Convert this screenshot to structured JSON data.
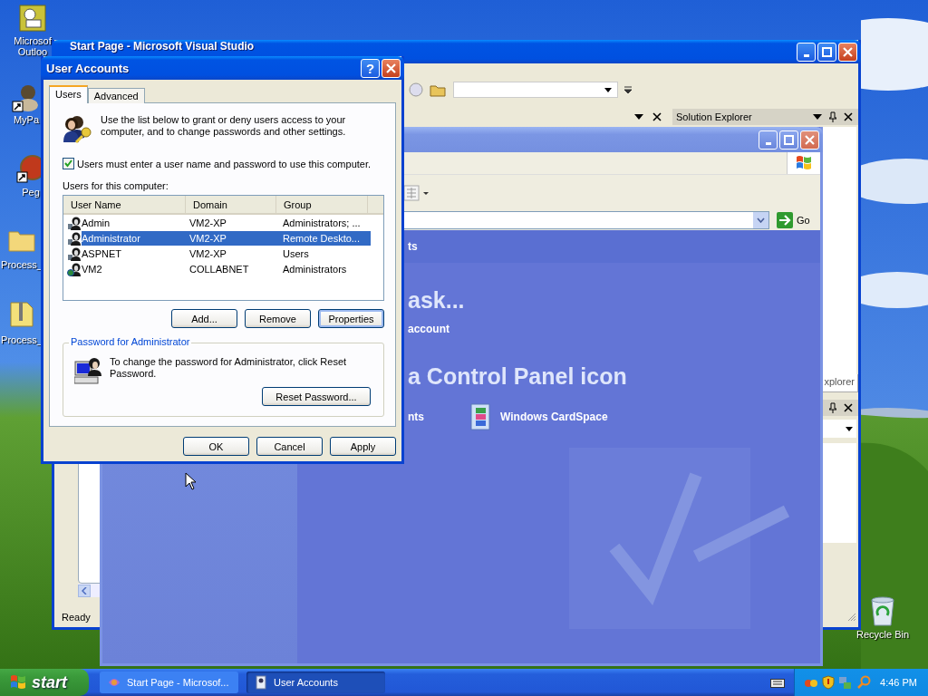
{
  "desktop_icons": [
    {
      "kind": "outlook",
      "lines": [
        "Microsof",
        "Outloo"
      ]
    },
    {
      "kind": "figure_shortcut",
      "lines": [
        "MyPa"
      ]
    },
    {
      "kind": "ball_shortcut",
      "lines": [
        "Peg"
      ]
    },
    {
      "kind": "folder",
      "lines": [
        "Process_"
      ]
    },
    {
      "kind": "zip",
      "lines": [
        "Process_"
      ]
    },
    {
      "kind": "recycle",
      "lines": [
        "Recycle Bin"
      ]
    }
  ],
  "vs_window": {
    "title": "Start Page - Microsoft Visual Studio",
    "solution_explorer": {
      "title": "Solution Explorer"
    },
    "side_tab": "xplorer",
    "status": "Ready"
  },
  "control_panel": {
    "header": "ts",
    "heading_1": "ask...",
    "task_link": "account",
    "heading_2": "a Control Panel icon",
    "items": [
      {
        "kind": "partial",
        "label": "nts"
      },
      {
        "kind": "cardspace",
        "label": "Windows CardSpace"
      }
    ],
    "go": "Go"
  },
  "dialog": {
    "title": "User Accounts",
    "help_glyph": "?",
    "tabs": [
      {
        "label": "Users",
        "selected": true
      },
      {
        "label": "Advanced",
        "selected": false
      }
    ],
    "intro": "Use the list below to grant or deny users access to your computer, and to change passwords and other settings.",
    "checkbox": {
      "label": "Users must enter a user name and password to use this computer.",
      "checked": true
    },
    "list_label": "Users for this computer:",
    "columns": [
      "User Name",
      "Domain",
      "Group"
    ],
    "rows": [
      {
        "kind": "local",
        "user": "Admin",
        "domain": "VM2-XP",
        "group": "Administrators; ...",
        "selected": false
      },
      {
        "kind": "local",
        "user": "Administrator",
        "domain": "VM2-XP",
        "group": "Remote Deskto...",
        "selected": true
      },
      {
        "kind": "local",
        "user": "ASPNET",
        "domain": "VM2-XP",
        "group": "Users",
        "selected": false
      },
      {
        "kind": "domain",
        "user": "VM2",
        "domain": "COLLABNET",
        "group": "Administrators",
        "selected": false
      }
    ],
    "list_buttons": [
      {
        "label": "Add...",
        "focused": false
      },
      {
        "label": "Remove",
        "focused": false
      },
      {
        "label": "Properties",
        "focused": true
      }
    ],
    "password_group": {
      "title": "Password for Administrator",
      "text": "To change the password for Administrator, click Reset Password.",
      "button": "Reset Password..."
    },
    "footer_buttons": [
      "OK",
      "Cancel",
      "Apply"
    ]
  },
  "taskbar": {
    "start": "start",
    "tasks": [
      {
        "kind": "vs",
        "label": "Start Page - Microsof...",
        "selected": false
      },
      {
        "kind": "users",
        "label": "User Accounts",
        "selected": true
      }
    ],
    "clock": "4:46 PM"
  }
}
